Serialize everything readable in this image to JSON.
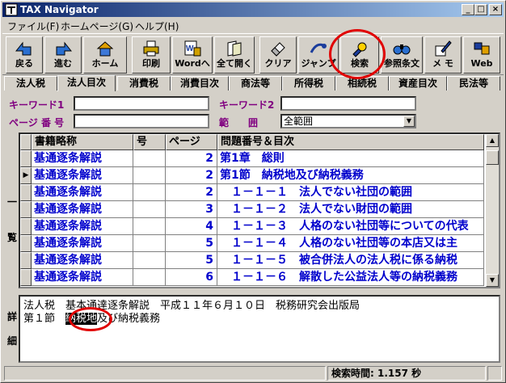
{
  "window": {
    "title": "TAX Navigator",
    "minimize": "_",
    "maximize": "□",
    "close": "×"
  },
  "menu": [
    {
      "label": "ファイル(F)"
    },
    {
      "label": "ホームページ(G)"
    },
    {
      "label": "ヘルプ(H)"
    }
  ],
  "toolbar": [
    {
      "label": "戻る",
      "icon": "back-arrow-icon"
    },
    {
      "label": "進む",
      "icon": "forward-arrow-icon"
    },
    {
      "label": "ホーム",
      "icon": "home-icon"
    },
    {
      "label": "印刷",
      "icon": "printer-icon"
    },
    {
      "label": "Wordへ",
      "icon": "word-export-icon"
    },
    {
      "label": "全て開く",
      "icon": "open-all-icon"
    },
    {
      "label": "クリア",
      "icon": "eraser-icon"
    },
    {
      "label": "ジャンプ",
      "icon": "jump-icon"
    },
    {
      "label": "検索",
      "icon": "search-flashlight-icon"
    },
    {
      "label": "参照条文",
      "icon": "binoculars-icon"
    },
    {
      "label": "メ モ",
      "icon": "memo-pen-icon"
    },
    {
      "label": "Web",
      "icon": "web-icon"
    }
  ],
  "tabs": [
    {
      "label": "法人税"
    },
    {
      "label": "法人目次",
      "active": true
    },
    {
      "label": "消費税"
    },
    {
      "label": "消費目次"
    },
    {
      "label": "商法等"
    },
    {
      "label": "所得税"
    },
    {
      "label": "相続税"
    },
    {
      "label": "資産目次"
    },
    {
      "label": "民法等"
    }
  ],
  "search": {
    "keyword1_label": "キーワード1",
    "keyword1_value": "",
    "keyword2_label": "キーワード2",
    "keyword2_value": "",
    "page_label": "ページ 番 号",
    "page_value": "",
    "range_label": "範　　囲",
    "range_value": "全範囲"
  },
  "side_labels": {
    "list_top": "一",
    "list_bottom": "覧",
    "detail_top": "詳",
    "detail_bottom": "細"
  },
  "grid": {
    "columns": [
      "書籍略称",
      "号",
      "ページ",
      "問題番号＆目次"
    ],
    "rows": [
      {
        "book": "基通逐条解説",
        "no": "",
        "page": "2",
        "title": "第1章　総則"
      },
      {
        "book": "基通逐条解説",
        "no": "",
        "page": "2",
        "title": "第1節　納税地及び納税義務",
        "current": true
      },
      {
        "book": "基通逐条解説",
        "no": "",
        "page": "2",
        "title": "　１－１－１　法人でない社団の範囲"
      },
      {
        "book": "基通逐条解説",
        "no": "",
        "page": "3",
        "title": "　１－１－２　法人でない財団の範囲"
      },
      {
        "book": "基通逐条解説",
        "no": "",
        "page": "4",
        "title": "　１－１－３　人格のない社団等についての代表"
      },
      {
        "book": "基通逐条解説",
        "no": "",
        "page": "5",
        "title": "　１－１－４　人格のない社団等の本店又は主"
      },
      {
        "book": "基通逐条解説",
        "no": "",
        "page": "5",
        "title": "　１－１－５　被合併法人の法人税に係る納税"
      },
      {
        "book": "基通逐条解説",
        "no": "",
        "page": "6",
        "title": "　１－１－６　解散した公益法人等の納税義務"
      }
    ]
  },
  "detail": {
    "line1": "法人税　基本通達逐条解説　平成１１年６月１０日　税務研究会出版局",
    "line2_before": "第１節　",
    "line2_highlight": "納税地",
    "line2_after": "及び納税義務"
  },
  "status": {
    "search_time": "検索時間:  1.157 秒"
  },
  "colors": {
    "accent_label": "#800080",
    "row_text": "#0000cc",
    "annotation_circle": "#e00000"
  }
}
